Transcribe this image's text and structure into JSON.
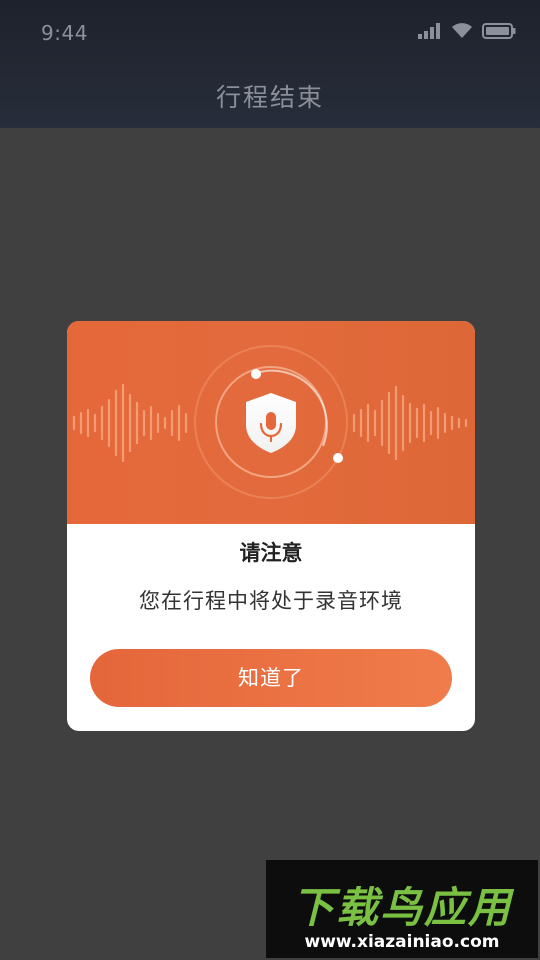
{
  "status_bar": {
    "time": "9:44",
    "icons": [
      "signal-icon",
      "wifi-icon",
      "battery-icon"
    ]
  },
  "header": {
    "title": "行程结束"
  },
  "dialog": {
    "illustration": "shield-mic-icon",
    "title": "请注意",
    "message": "您在行程中将处于录音环境",
    "confirm_label": "知道了",
    "accent_color": "#e5683a"
  },
  "watermark": {
    "brand": "下载鸟应用",
    "url": "www.xiazainiao.com"
  }
}
